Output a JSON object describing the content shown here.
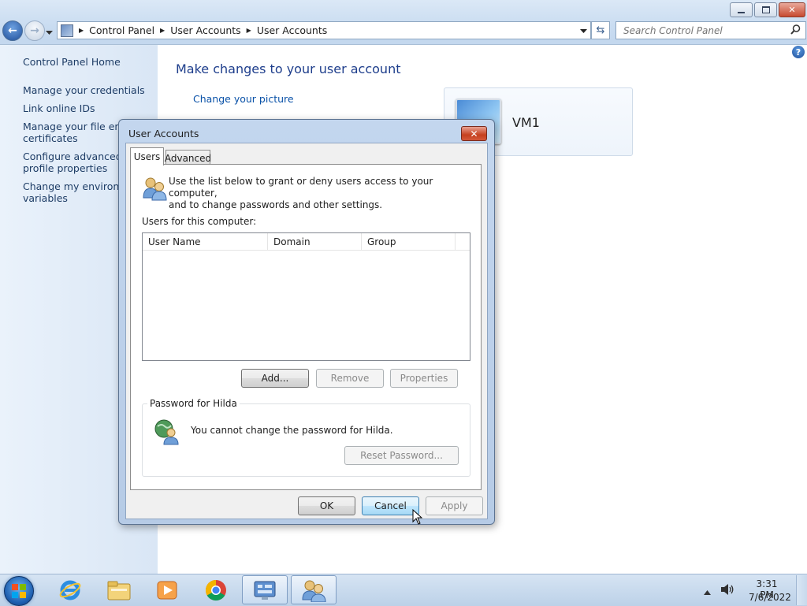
{
  "window": {
    "breadcrumb": [
      "Control Panel",
      "User Accounts",
      "User Accounts"
    ],
    "search_placeholder": "Search Control Panel"
  },
  "left_pane": {
    "items": [
      {
        "label": "Control Panel Home"
      },
      {
        "label": "Manage your credentials"
      },
      {
        "label": "Link online IDs"
      },
      {
        "label": "Manage your file encry\ncertificates"
      },
      {
        "label": "Configure advanced us\nprofile properties"
      },
      {
        "label": "Change my environme\nvariables"
      }
    ]
  },
  "main": {
    "title": "Make changes to your user account",
    "change_picture": "Change your picture",
    "account_name": "VM1"
  },
  "dialog": {
    "title": "User Accounts",
    "close_glyph": "✕",
    "tabs": [
      "Users",
      "Advanced"
    ],
    "intro": "Use the list below to grant or deny users access to your computer,\nand to change passwords and other settings.",
    "users_label": "Users for this computer:",
    "columns": [
      "User Name",
      "Domain",
      "Group"
    ],
    "buttons": {
      "add": "Add...",
      "remove": "Remove",
      "properties": "Properties"
    },
    "password_group": {
      "title": "Password for Hilda",
      "message": "You cannot change the password for Hilda.",
      "reset_button": "Reset Password..."
    },
    "footer": {
      "ok": "OK",
      "cancel": "Cancel",
      "apply": "Apply"
    }
  },
  "taskbar": {
    "pinned": [
      {
        "icon": "internet-explorer-icon"
      },
      {
        "icon": "file-explorer-icon"
      },
      {
        "icon": "media-player-icon"
      },
      {
        "icon": "chrome-icon"
      },
      {
        "icon": "control-panel-icon",
        "active": true
      },
      {
        "icon": "user-accounts-icon",
        "active": true
      }
    ],
    "clock": {
      "time": "3:31 PM",
      "date": "7/6/2022"
    }
  },
  "colors": {
    "link": "#1e3d66",
    "title_blue": "#1e3e8c",
    "taskbar": "#bcd1e8"
  }
}
